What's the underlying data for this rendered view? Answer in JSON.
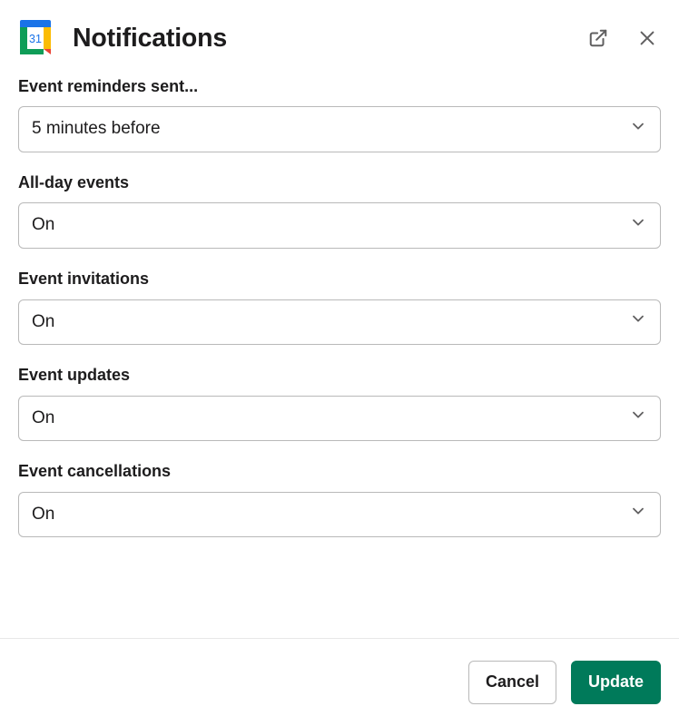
{
  "header": {
    "title": "Notifications"
  },
  "fields": {
    "reminders": {
      "label": "Event reminders sent...",
      "value": "5 minutes before"
    },
    "all_day": {
      "label": "All-day events",
      "value": "On"
    },
    "invites": {
      "label": "Event invitations",
      "value": "On"
    },
    "updates": {
      "label": "Event updates",
      "value": "On"
    },
    "cancels": {
      "label": "Event cancellations",
      "value": "On"
    }
  },
  "footer": {
    "cancel": "Cancel",
    "update": "Update"
  },
  "icons": {
    "calendar_day": "31"
  }
}
